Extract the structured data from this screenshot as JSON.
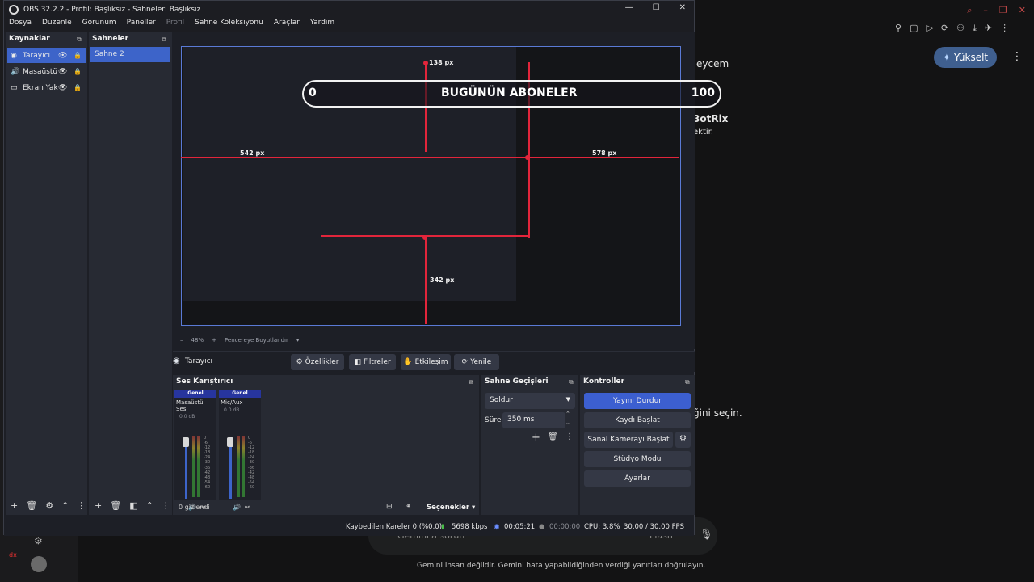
{
  "browser": {
    "upgrade_label": "Yükselt",
    "partial_text_1": "eycem",
    "partial_text_2": "3otRix",
    "partial_text_3": "ektir.",
    "partial_text_4": "ğini seçin.",
    "input_placeholder": "Gemini'a sorun",
    "model_label": "Flash",
    "disclaimer": "Gemini insan değildir. Gemini hata yapabildiğinden verdiği yanıtları doğrulayın.",
    "side_label": "dx"
  },
  "obs": {
    "window_title": "OBS 32.2.2 - Profil: Başlıksız - Sahneler: Başlıksız",
    "menu": [
      "Dosya",
      "Düzenle",
      "Görünüm",
      "Paneller",
      "Profil",
      "Sahne Koleksiyonu",
      "Araçlar",
      "Yardım"
    ],
    "sources": {
      "title": "Kaynaklar",
      "items": [
        {
          "label": "Tarayıcı",
          "selected": true
        },
        {
          "label": "Masaüstü",
          "selected": false
        },
        {
          "label": "Ekran Yak",
          "selected": false
        }
      ]
    },
    "scenes": {
      "title": "Sahneler",
      "items": [
        {
          "label": "Sahne 2",
          "selected": true
        }
      ]
    },
    "preview": {
      "subs_zero": "0",
      "subs_title": "BUGÜNÜN ABONELER",
      "subs_hundred": "100",
      "dist_top": "138 px",
      "dist_left": "542 px",
      "dist_right": "578 px",
      "dist_bottom": "342 px",
      "zoom": "48%",
      "fit_label": "Pencereye Boyutlandır"
    },
    "context_bar": {
      "source_name": "Tarayıcı",
      "properties": "Özellikler",
      "filters": "Filtreler",
      "interact": "Etkileşim",
      "refresh": "Yenile"
    },
    "mixer": {
      "title": "Ses Karıştırıcı",
      "channels": [
        {
          "tag": "Genel",
          "name": "Masaüstü Ses",
          "db": "0.0 dB"
        },
        {
          "tag": "Genel",
          "name": "Mic/Aux",
          "db": "0.0 dB"
        }
      ],
      "scale": [
        "0",
        "-6",
        "-12",
        "-18",
        "-24",
        "-30",
        "-36",
        "-42",
        "-48",
        "-54",
        "-60"
      ],
      "hidden_label": "0 gizlendi",
      "options_label": "Seçenekler"
    },
    "transitions": {
      "title": "Sahne Geçişleri",
      "type": "Soldur",
      "duration_label": "Süre",
      "duration_value": "350 ms"
    },
    "controls": {
      "title": "Kontroller",
      "buttons": [
        "Yayını Durdur",
        "Kaydı Başlat",
        "Sanal Kamerayı Başlat",
        "Stüdyo Modu",
        "Ayarlar"
      ]
    },
    "status": {
      "dropped": "Kaybedilen Kareler 0 (%0.0)",
      "bitrate": "5698 kbps",
      "stream_time": "00:05:21",
      "rec_time": "00:00:00",
      "cpu": "CPU: 3.8%",
      "fps": "30.00 / 30.00 FPS"
    }
  }
}
